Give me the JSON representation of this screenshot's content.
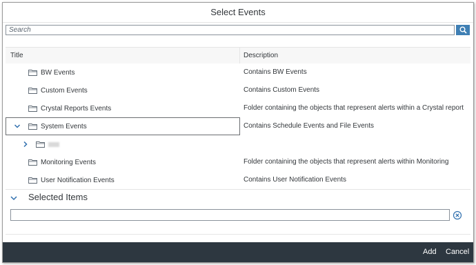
{
  "dialog": {
    "title": "Select Events"
  },
  "search": {
    "placeholder": "Search",
    "value": "",
    "button_icon": "search-icon"
  },
  "table": {
    "columns": [
      "Title",
      "Description"
    ],
    "rows": [
      {
        "title": "BW Events",
        "description": "Contains BW Events"
      },
      {
        "title": "Custom Events",
        "description": "Contains Custom Events"
      },
      {
        "title": "Crystal Reports Events",
        "description": "Folder containing the objects that represent alerts within a Crystal report"
      },
      {
        "title": "System Events",
        "description": "Contains Schedule Events and File Events",
        "expanded": true,
        "selected": true
      },
      {
        "title": "",
        "description": "",
        "child": true,
        "collapsed": true
      },
      {
        "title": "Monitoring Events",
        "description": "Folder containing the objects that represent alerts within Monitoring"
      },
      {
        "title": "User Notification Events",
        "description": "Contains User Notification Events"
      }
    ]
  },
  "selected_items": {
    "title": "Selected Items",
    "value": "",
    "expanded": true
  },
  "footer": {
    "add_label": "Add",
    "cancel_label": "Cancel"
  },
  "colors": {
    "accent": "#3f7fb4",
    "footer_bg": "#2d3740",
    "icon_blue": "#2f6fae"
  }
}
